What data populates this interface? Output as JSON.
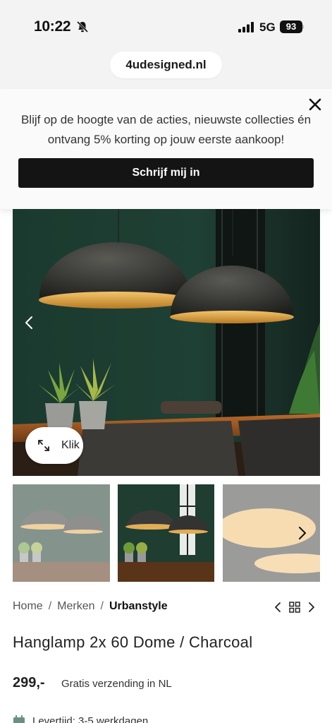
{
  "status_bar": {
    "time": "10:22",
    "network": "5G",
    "battery": "93"
  },
  "browser": {
    "url": "4udesigned.nl"
  },
  "banner": {
    "text": "Blijf op de hoogte van de acties, nieuwste collecties én ontvang 5% korting op jouw eerste aankoop!",
    "button_label": "Schrijf mij in"
  },
  "gallery": {
    "zoom_label": "Klik"
  },
  "breadcrumb": {
    "home": "Home",
    "brands": "Merken",
    "current": "Urbanstyle"
  },
  "product": {
    "title": "Hanglamp 2x 60 Dome / Charcoal",
    "price": "299,-",
    "shipping": "Gratis verzending in NL",
    "delivery": "Levertijd: 3-5 werkdagen"
  }
}
